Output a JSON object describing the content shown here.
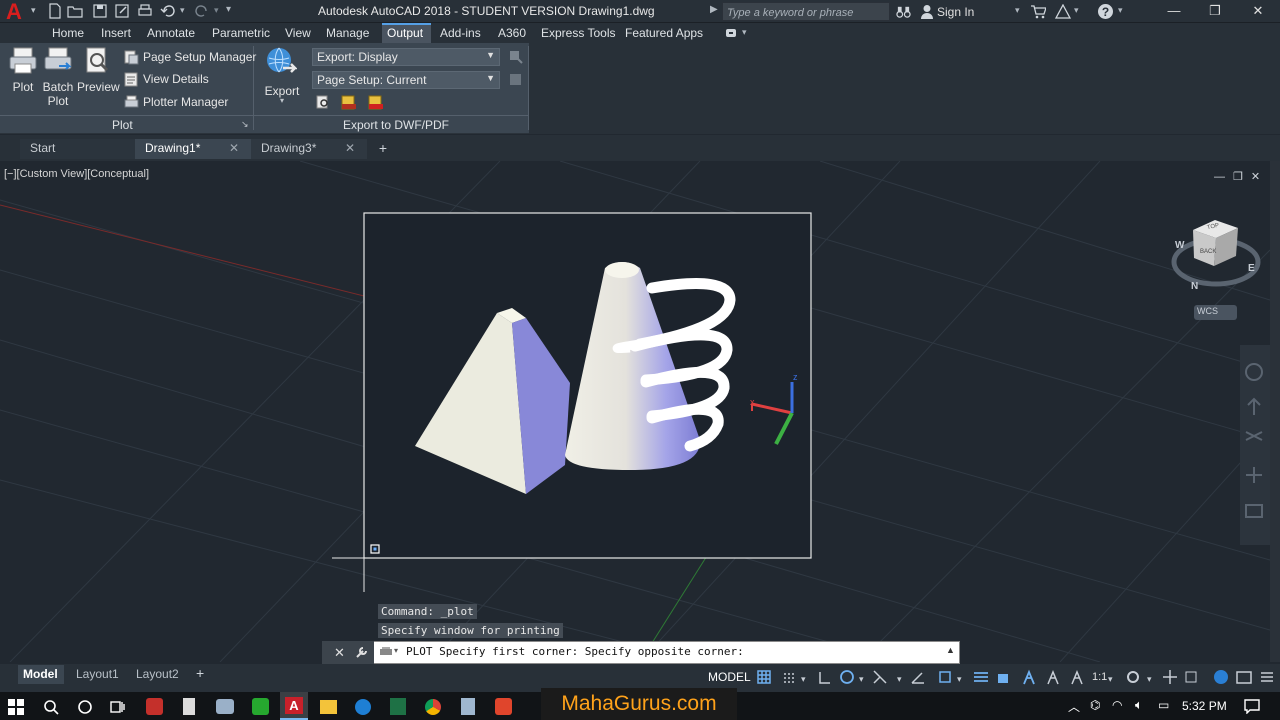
{
  "titlebar": {
    "window_title": "Autodesk AutoCAD 2018 - STUDENT VERSION    Drawing1.dwg",
    "search_placeholder": "Type a keyword or phrase",
    "signin_label": "Sign In"
  },
  "ribbon_tabs": [
    "Home",
    "Insert",
    "Annotate",
    "Parametric",
    "View",
    "Manage",
    "Output",
    "Add-ins",
    "A360",
    "Express Tools",
    "Featured Apps"
  ],
  "active_tab": "Output",
  "plot_panel": {
    "title": "Plot",
    "plot_label": "Plot",
    "batch_plot_label_1": "Batch",
    "batch_plot_label_2": "Plot",
    "preview_label": "Preview",
    "page_setup_manager": "Page Setup Manager",
    "view_details": "View Details",
    "plotter_manager": "Plotter Manager"
  },
  "export_panel": {
    "title": "Export to DWF/PDF",
    "export_label": "Export",
    "export_dropdown": "Export: Display",
    "page_setup_dropdown": "Page Setup: Current"
  },
  "doc_tabs": {
    "start": "Start",
    "drawing1": "Drawing1*",
    "drawing3": "Drawing3*"
  },
  "viewport": {
    "view_label": "[−][Custom View][Conceptual]",
    "wcs_label": "WCS",
    "viewcube_top": "TOP",
    "viewcube_back": "BACK",
    "compass_n": "N",
    "compass_e": "E",
    "compass_w": "W"
  },
  "command": {
    "history_1": "Command: _plot",
    "history_2": "Specify window for printing",
    "input_prompt": "PLOT Specify first corner: Specify opposite corner:"
  },
  "statusbar": {
    "model_tab": "Model",
    "layout1": "Layout1",
    "layout2": "Layout2",
    "space_label": "MODEL",
    "scale": "1:1"
  },
  "taskbar": {
    "watermark": "MahaGurus.com",
    "clock": "5:32 PM"
  },
  "colors": {
    "accent": "#55a0e6",
    "brand_red": "#d81e1e",
    "watermark": "#ffa21a"
  }
}
